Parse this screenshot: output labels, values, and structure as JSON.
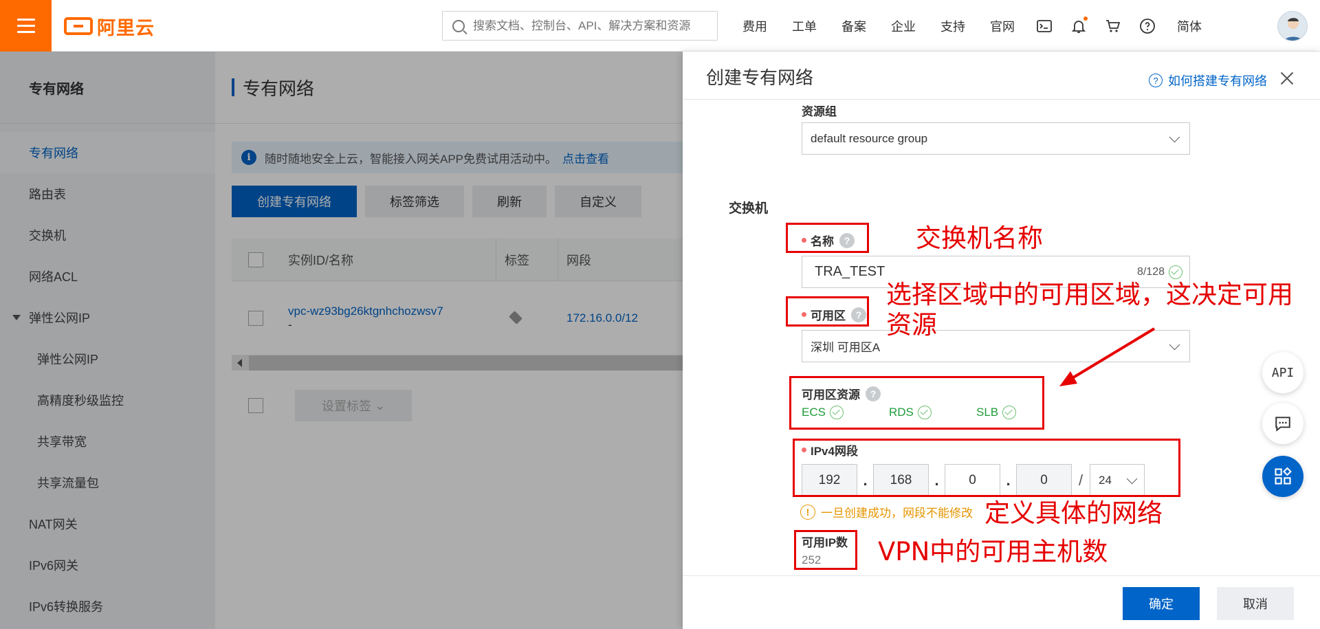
{
  "brand": {
    "name": "阿里云",
    "accent": "#ff6a00"
  },
  "search": {
    "placeholder": "搜索文档、控制台、API、解决方案和资源"
  },
  "nav": [
    "费用",
    "工单",
    "备案",
    "企业",
    "支持",
    "官网"
  ],
  "nav_icons": [
    "terminal-icon",
    "bell-icon",
    "cart-icon",
    "help-icon"
  ],
  "lang": "简体",
  "sidebar": {
    "title": "专有网络",
    "items": [
      {
        "label": "专有网络"
      },
      {
        "label": "路由表"
      },
      {
        "label": "交换机"
      },
      {
        "label": "网络ACL"
      },
      {
        "label": "弹性公网IP"
      },
      {
        "label": "弹性公网IP"
      },
      {
        "label": "高精度秒级监控"
      },
      {
        "label": "共享带宽"
      },
      {
        "label": "共享流量包"
      },
      {
        "label": "NAT网关"
      },
      {
        "label": "IPv6网关"
      },
      {
        "label": "IPv6转换服务"
      }
    ]
  },
  "main": {
    "title": "专有网络",
    "notice": "随时随地安全上云，智能接入网关APP免费试用活动中。",
    "notice_link": "点击查看",
    "buttons": {
      "create": "创建专有网络",
      "tag_filter": "标签筛选",
      "refresh": "刷新",
      "customize": "自定义"
    },
    "columns": {
      "id": "实例ID/名称",
      "tags": "标签",
      "cidr": "网段"
    },
    "row": {
      "id": "vpc-wz93bg26ktgnhchozwsv7",
      "name": "-",
      "cidr": "172.16.0.0/12"
    },
    "set_tags": "设置标签"
  },
  "drawer": {
    "title": "创建专有网络",
    "help": "如何搭建专有网络",
    "resource_group_label": "资源组",
    "resource_group_value": "default resource group",
    "section": "交换机",
    "name_label": "名称",
    "name_value": "TRA_TEST",
    "name_counter": "8/128",
    "zone_label": "可用区",
    "zone_value": "深圳 可用区A",
    "zone_resources_label": "可用区资源",
    "resources": [
      "ECS",
      "RDS",
      "SLB"
    ],
    "ipv4_label": "IPv4网段",
    "ipv4": [
      "192",
      "168",
      "0",
      "0"
    ],
    "ipv4_mask": "24",
    "warning": "一旦创建成功，网段不能修改",
    "ip_count_label": "可用IP数",
    "ip_count_value": "252",
    "ok": "确定",
    "cancel": "取消"
  },
  "annotations": {
    "name": "交换机名称",
    "zone": "选择区域中的可用区域，这决定可用资源",
    "network": "定义具体的网络",
    "hosts": "VPN中的可用主机数"
  },
  "float": {
    "api": "API"
  }
}
